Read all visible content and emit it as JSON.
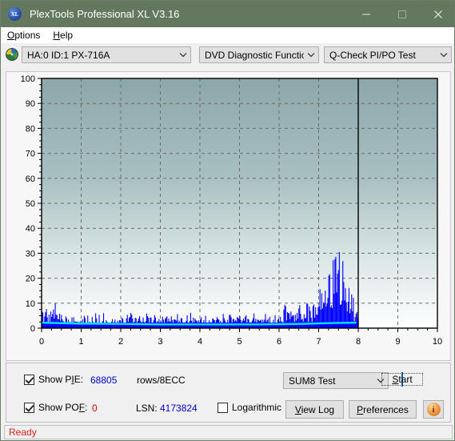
{
  "window": {
    "title": "PlexTools Professional XL V3.16",
    "icon": "xl-app-icon",
    "icon_text": "XL",
    "minimize": "minimize-icon",
    "maximize": "maximize-icon",
    "close": "close-icon",
    "titlebar_color": "#63785f"
  },
  "menubar": {
    "items": [
      {
        "label": "Options",
        "accel": "O"
      },
      {
        "label": "Help",
        "accel": "H"
      }
    ]
  },
  "toolbar": {
    "drive_icon": "disc-icon",
    "drive_select": {
      "value": "HA:0 ID:1  PX-716A",
      "arrow": "chevron-down-icon"
    },
    "function_select": {
      "value": "DVD Diagnostic Functions",
      "arrow": "chevron-down-icon"
    },
    "test_select": {
      "value": "Q-Check PI/PO Test",
      "arrow": "chevron-down-icon"
    }
  },
  "controls": {
    "show_pie": {
      "label": "Show PIE:",
      "accel": "I",
      "checked": true,
      "value": "68805",
      "value_color": "#0000cc",
      "units": "rows/8ECC"
    },
    "show_pof": {
      "label": "Show POF:",
      "accel": "F",
      "checked": true,
      "value": "0",
      "value_color": "#cc0000"
    },
    "lsn": {
      "label": "LSN:",
      "value": "4173824",
      "value_color": "#0000cc"
    },
    "logarithmic": {
      "label": "Logarithmic",
      "checked": false
    },
    "test_mode_select": {
      "value": "SUM8 Test",
      "arrow": "chevron-down-icon"
    },
    "start_button": "Start",
    "start_accel": "S",
    "view_log_button": "View Log",
    "view_log_accel": "V",
    "preferences_button": "Preferences",
    "preferences_accel": "P",
    "info_button": "i"
  },
  "statusbar": {
    "text": "Ready",
    "color": "#e01b1b"
  },
  "chart_data": {
    "type": "area",
    "title": "",
    "xlabel": "",
    "ylabel": "",
    "xlim": [
      0,
      10
    ],
    "ylim": [
      0,
      100
    ],
    "xticks": [
      0,
      1,
      2,
      3,
      4,
      5,
      6,
      7,
      8,
      9,
      10
    ],
    "yticks": [
      0,
      10,
      20,
      30,
      40,
      50,
      60,
      70,
      80,
      90,
      100
    ],
    "grid": true,
    "legend": "none",
    "data_end_x": 8.0,
    "marker_line_x": 8.0,
    "plot_bg_top": "#8ea8ab",
    "plot_bg_bottom": "#ffffff",
    "series": [
      {
        "name": "PIE",
        "color": "#0000ff",
        "type": "bar-spikes",
        "x": [
          0.0,
          0.05,
          0.1,
          0.15,
          0.2,
          0.25,
          0.3,
          0.35,
          0.4,
          0.45,
          0.5,
          0.55,
          0.6,
          0.65,
          0.7,
          0.75,
          0.8,
          0.85,
          0.9,
          0.95,
          1.0,
          1.05,
          1.1,
          1.15,
          1.2,
          1.25,
          1.3,
          1.35,
          1.4,
          1.45,
          1.5,
          1.55,
          1.6,
          1.65,
          1.7,
          1.75,
          1.8,
          1.85,
          1.9,
          1.95,
          2.0,
          2.05,
          2.1,
          2.15,
          2.2,
          2.25,
          2.3,
          2.35,
          2.4,
          2.45,
          2.5,
          2.55,
          2.6,
          2.65,
          2.7,
          2.75,
          2.8,
          2.85,
          2.9,
          2.95,
          3.0,
          3.05,
          3.1,
          3.15,
          3.2,
          3.25,
          3.3,
          3.35,
          3.4,
          3.45,
          3.5,
          3.55,
          3.6,
          3.65,
          3.7,
          3.75,
          3.8,
          3.85,
          3.9,
          3.95,
          4.0,
          4.05,
          4.1,
          4.15,
          4.2,
          4.25,
          4.3,
          4.35,
          4.4,
          4.45,
          4.5,
          4.55,
          4.6,
          4.65,
          4.7,
          4.75,
          4.8,
          4.85,
          4.9,
          4.95,
          5.0,
          5.05,
          5.1,
          5.15,
          5.2,
          5.25,
          5.3,
          5.35,
          5.4,
          5.45,
          5.5,
          5.55,
          5.6,
          5.65,
          5.7,
          5.75,
          5.8,
          5.85,
          5.9,
          5.95,
          6.0,
          6.05,
          6.1,
          6.15,
          6.2,
          6.25,
          6.3,
          6.35,
          6.4,
          6.45,
          6.5,
          6.55,
          6.6,
          6.65,
          6.7,
          6.75,
          6.8,
          6.85,
          6.9,
          6.95,
          7.0,
          7.05,
          7.1,
          7.15,
          7.2,
          7.25,
          7.3,
          7.35,
          7.4,
          7.45,
          7.5,
          7.55,
          7.6,
          7.65,
          7.7,
          7.75,
          7.8,
          7.85,
          7.9,
          7.95
        ],
        "values": [
          6.0,
          4.5,
          7.5,
          4.0,
          6.5,
          3.5,
          8.5,
          4.5,
          5.5,
          3.5,
          4.0,
          3.0,
          3.5,
          2.5,
          3.5,
          3.0,
          4.5,
          3.0,
          3.5,
          2.5,
          3.0,
          4.5,
          3.0,
          5.0,
          3.0,
          3.5,
          2.5,
          4.5,
          3.0,
          3.5,
          2.5,
          4.0,
          3.0,
          3.5,
          2.5,
          4.5,
          3.0,
          3.5,
          2.5,
          4.0,
          3.0,
          3.5,
          2.5,
          4.5,
          3.0,
          5.0,
          3.0,
          3.5,
          2.5,
          4.0,
          3.0,
          3.5,
          2.5,
          4.5,
          3.0,
          3.5,
          2.5,
          4.0,
          3.0,
          3.5,
          2.5,
          4.5,
          3.0,
          3.5,
          2.5,
          4.0,
          3.0,
          3.5,
          2.5,
          4.5,
          3.0,
          3.5,
          2.5,
          4.0,
          3.0,
          5.0,
          3.0,
          3.5,
          2.5,
          4.0,
          3.0,
          3.5,
          2.5,
          4.5,
          3.0,
          3.5,
          2.5,
          4.0,
          3.0,
          3.5,
          2.5,
          4.5,
          3.0,
          3.5,
          2.5,
          4.0,
          3.0,
          3.5,
          2.5,
          4.5,
          3.0,
          3.5,
          2.5,
          4.0,
          3.0,
          3.5,
          2.5,
          4.5,
          3.0,
          3.5,
          2.5,
          4.0,
          3.0,
          4.5,
          3.0,
          3.5,
          2.5,
          4.0,
          3.0,
          3.5,
          4.0,
          5.5,
          4.5,
          8.0,
          5.0,
          4.5,
          5.5,
          4.0,
          5.0,
          4.5,
          6.0,
          5.0,
          5.5,
          7.0,
          6.5,
          6.0,
          7.5,
          6.5,
          8.0,
          7.5,
          9.0,
          10.0,
          12.0,
          11.0,
          14.0,
          16.0,
          18.0,
          20.0,
          22.0,
          24.5,
          25.0,
          23.0,
          21.0,
          19.0,
          16.0,
          12.0,
          9.0,
          11.0,
          7.0,
          10.0
        ]
      },
      {
        "name": "POF",
        "color": "#00e5ff",
        "type": "line",
        "x": [
          0.0,
          0.5,
          1.0,
          1.5,
          2.0,
          2.5,
          3.0,
          3.5,
          4.0,
          4.5,
          5.0,
          5.5,
          6.0,
          6.5,
          7.0,
          7.5,
          7.95
        ],
        "values": [
          2.2,
          2.0,
          1.8,
          1.8,
          1.7,
          1.6,
          1.5,
          1.5,
          1.5,
          1.5,
          1.5,
          1.5,
          1.6,
          1.7,
          1.9,
          2.1,
          2.2
        ]
      }
    ]
  }
}
